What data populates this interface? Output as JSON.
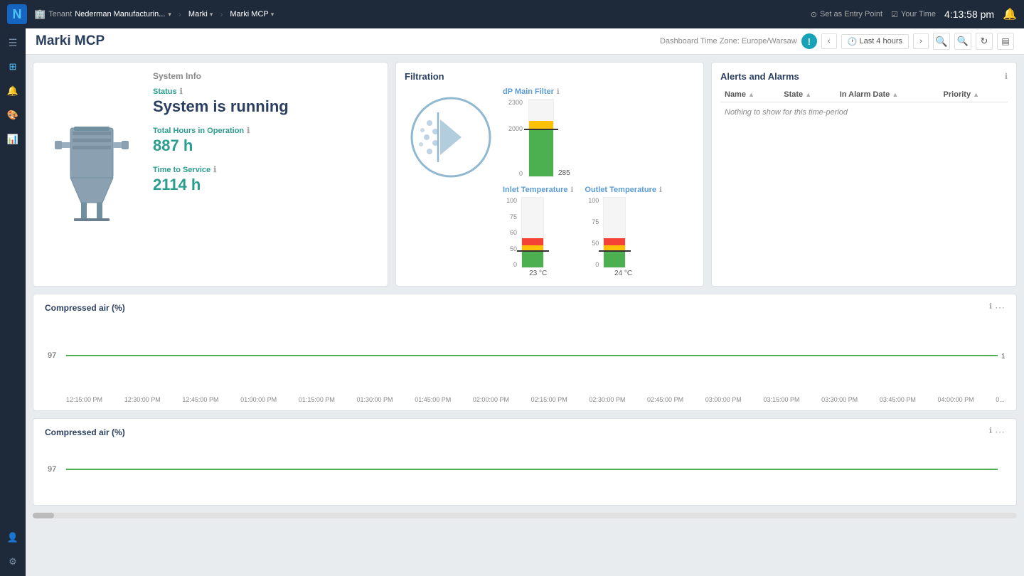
{
  "topnav": {
    "logo": "N",
    "tenant_label": "Tenant",
    "tenant_icon": "🏢",
    "breadcrumb": [
      {
        "label": "Nederman Manufacturin...",
        "has_dropdown": true
      },
      {
        "label": "Marki",
        "has_dropdown": true
      },
      {
        "label": "Marki MCP",
        "has_dropdown": true
      }
    ],
    "entry_point_label": "Set as Entry Point",
    "your_time_label": "Your Time",
    "time": "4:13:58 pm",
    "bell_icon": "🔔"
  },
  "page_header": {
    "title": "Marki MCP",
    "timezone_label": "Dashboard Time Zone: Europe/Warsaw",
    "time_range_label": "Last 4 hours",
    "info_btn": "!",
    "zoom_in_label": "+",
    "zoom_out_label": "−",
    "refresh_label": "↻",
    "panel_label": "≡"
  },
  "sidebar": {
    "items": [
      {
        "icon": "☰",
        "name": "menu-toggle"
      },
      {
        "icon": "⊞",
        "name": "dashboard"
      },
      {
        "icon": "🔔",
        "name": "notifications"
      },
      {
        "icon": "🎨",
        "name": "themes"
      },
      {
        "icon": "📊",
        "name": "analytics"
      },
      {
        "icon": "👤",
        "name": "user"
      },
      {
        "icon": "⚙",
        "name": "settings"
      }
    ]
  },
  "system_info": {
    "section_title": "System Info",
    "status_label": "Status",
    "status_text": "System is running",
    "hours_label": "Total Hours in Operation",
    "hours_info": "ℹ",
    "hours_value": "887 h",
    "service_label": "Time to Service",
    "service_info": "ℹ",
    "service_value": "2114 h"
  },
  "filtration": {
    "section_title": "Filtration",
    "dp_main_filter": {
      "title": "dP Main Filter",
      "y_labels": [
        "2300",
        "2000",
        "",
        "0"
      ],
      "bar_value": "285",
      "bar_segments": {
        "green_pct": 60,
        "yellow_pct": 15,
        "red_pct": 0
      }
    },
    "inlet_temperature": {
      "title": "Inlet Temperature",
      "y_labels": [
        "100",
        "75",
        "60",
        "50",
        "0"
      ],
      "value": "23 °C",
      "bar_segments": {
        "green_bottom_pct": 22,
        "yellow_pct": 10,
        "red_pct": 10
      }
    },
    "outlet_temperature": {
      "title": "Outlet Temperature",
      "y_labels": [
        "100",
        "75",
        "50",
        "0"
      ],
      "value": "24 °C",
      "bar_segments": {
        "green_bottom_pct": 22,
        "yellow_pct": 10,
        "red_pct": 10
      }
    },
    "info_icon": "ℹ"
  },
  "alerts": {
    "section_title": "Alerts and Alarms",
    "columns": [
      "Name",
      "State",
      "In Alarm Date",
      "Priority"
    ],
    "empty_message": "Nothing to show for this time-period"
  },
  "compressed_air_1": {
    "title": "Compressed air (%)",
    "y_value": "97",
    "x_labels": [
      "12:15:00 PM",
      "12:30:00 PM",
      "12:45:00 PM",
      "01:00:00 PM",
      "01:15:00 PM",
      "01:30:00 PM",
      "01:45:00 PM",
      "02:00:00 PM",
      "02:15:00 PM",
      "02:30:00 PM",
      "02:45:00 PM",
      "03:00:00 PM",
      "03:15:00 PM",
      "03:30:00 PM",
      "03:45:00 PM",
      "04:00:00 PM",
      "0..."
    ],
    "line_value": 97,
    "line_color": "#4caf50"
  },
  "compressed_air_2": {
    "title": "Compressed air (%)",
    "y_value": "97",
    "line_value": 97,
    "line_color": "#4caf50"
  }
}
